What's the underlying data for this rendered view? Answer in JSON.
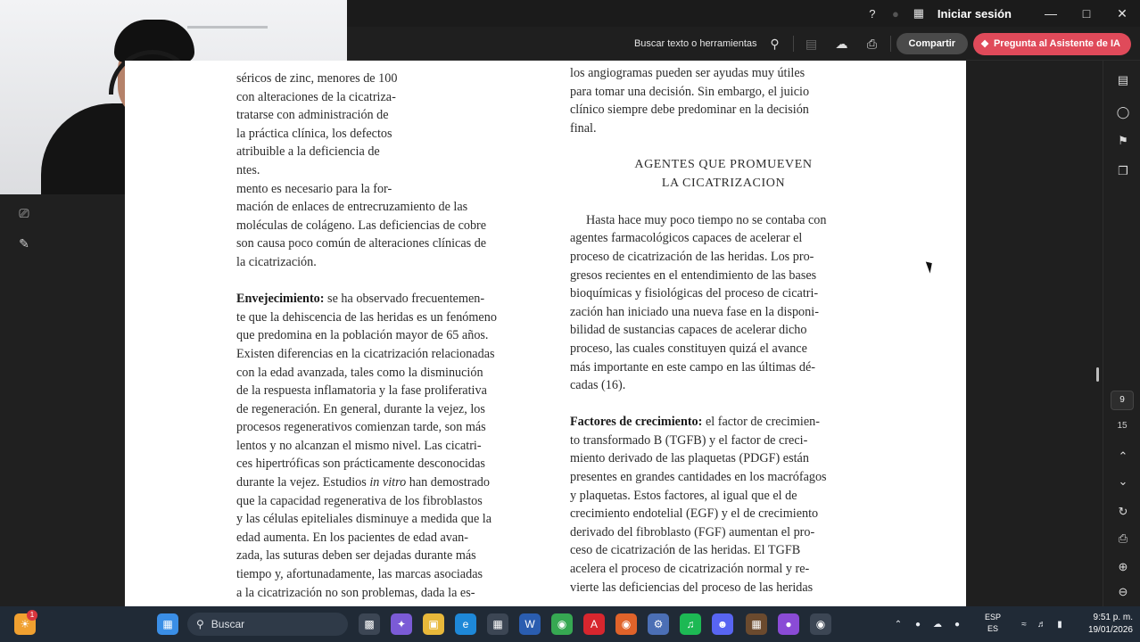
{
  "titlebar": {
    "signin_label": "Iniciar sesión",
    "icons": [
      "help-icon",
      "bell-icon",
      "apps-grid-icon"
    ],
    "window_controls": [
      "minimize-icon",
      "maximize-icon",
      "close-icon"
    ]
  },
  "toolbar": {
    "search_label": "Buscar texto o herramientas",
    "share_label": "Compartir",
    "ai_label": "Pregunta al Asistente de IA"
  },
  "left_tools": [
    "text-select-icon",
    "sign-pen-icon"
  ],
  "document": {
    "left_column": {
      "lines_top": [
        "séricos de zinc, menores de 100",
        "con alteraciones de la cicatriza-",
        "tratarse con administración de",
        "la práctica clínica, los defectos",
        "atribuible a la deficiencia de",
        "ntes.",
        "mento es necesario para la for-",
        "mación de enlaces de entrecruzamiento de las",
        "moléculas de colágeno. Las deficiencias de cobre",
        "son causa poco común de alteraciones clínicas de",
        "la cicatrización."
      ],
      "aging_title": "Envejecimiento:",
      "aging_first": " se ha observado frecuentemen-",
      "aging_lines": [
        "te que la dehiscencia de las heridas es un fenómeno",
        "que predomina en la población mayor de 65 años.",
        "Existen diferencias en la cicatrización relacionadas",
        "con la edad avanzada, tales como la disminución",
        "de la respuesta inflamatoria y la fase proliferativa",
        "de regeneración. En general, durante la vejez, los",
        "procesos regenerativos comienzan tarde, son más",
        "lentos y no alcanzan el mismo nivel. Las cicatri-",
        "ces hipertróficas son prácticamente desconocidas"
      ],
      "vitro_pre": "durante la vejez. Estudios ",
      "vitro_italic": "in vitro",
      "vitro_post": " han demostrado",
      "aging_tail": [
        "que la capacidad regenerativa de los fibroblastos",
        "y las células epiteliales disminuye a medida que la",
        "edad aumenta. En los pacientes de edad avan-",
        "zada, las suturas deben ser dejadas durante más",
        "tiempo y, afortunadamente, las marcas asociadas",
        "a la cicatrización no son problemas, dada la es-"
      ]
    },
    "right_column": {
      "lines_top": [
        "los angiogramas pueden ser ayudas muy útiles",
        "para tomar una decisión. Sin embargo, el juicio",
        "clínico siempre debe predominar en la decisión",
        "final."
      ],
      "heading_1": "AGENTES QUE PROMUEVEN",
      "heading_2": "LA CICATRIZACION",
      "intro_lines": [
        "Hasta hace muy poco tiempo no se contaba con",
        "agentes farmacológicos capaces de acelerar el",
        "proceso de cicatrización de las heridas. Los pro-",
        "gresos recientes en el entendimiento de las bases",
        "bioquímicas y fisiológicas del proceso de cicatri-",
        "zación han iniciado una nueva fase en la disponi-",
        "bilidad de sustancias capaces de acelerar dicho",
        "proceso, las cuales constituyen quizá el avance",
        "más importante en este campo en las últimas dé-",
        "cadas (16)."
      ],
      "growth_title": "Factores de crecimiento:",
      "growth_first": " el factor de crecimien-",
      "growth_lines": [
        "to transformado B (TGFB) y el factor de creci-",
        "miento derivado de las plaquetas (PDGF) están",
        "presentes en grandes cantidades en los macrófagos",
        "y plaquetas. Estos factores, al igual que el de",
        "crecimiento endotelial (EGF) y el de crecimiento",
        "derivado del fibroblasto (FGF) aumentan el pro-",
        "ceso de cicatrización de las heridas. El TGFB",
        "acelera el proceso de cicatrización normal y re-",
        "vierte las deficiencias del proceso de las heridas"
      ]
    }
  },
  "navigation": {
    "current_page": "9",
    "total_pages": "15"
  },
  "right_tools": [
    "ai-summary-icon",
    "comment-icon",
    "bookmark-icon",
    "copy-pages-icon",
    "chevron-up-icon",
    "chevron-down-icon",
    "refresh-icon",
    "save-icon",
    "zoom-in-icon",
    "zoom-out-icon"
  ],
  "taskbar": {
    "search_label": "Buscar",
    "lang_1": "ESP",
    "lang_2": "ES",
    "time": "9:51 p. m.",
    "date": "19/01/2026",
    "badge": "1"
  }
}
